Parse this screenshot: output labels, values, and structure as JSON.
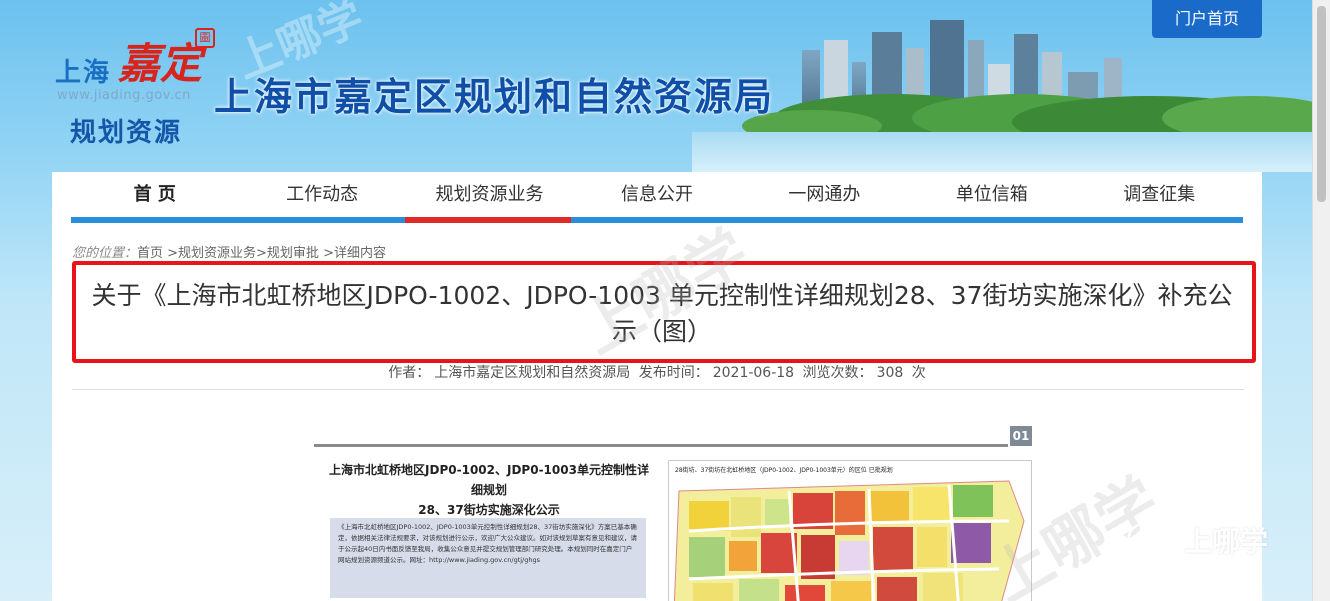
{
  "header": {
    "logo_city": "上海",
    "logo_district": "嘉定",
    "logo_seal": "圖",
    "logo_url": "www.jiading.gov.cn",
    "logo_sub": "规划资源",
    "site_title": "上海市嘉定区规划和自然资源局",
    "portal_button": "门户首页",
    "watermark": "上哪学"
  },
  "nav": {
    "items": [
      {
        "label": "首 页"
      },
      {
        "label": "工作动态"
      },
      {
        "label": "规划资源业务"
      },
      {
        "label": "信息公开"
      },
      {
        "label": "一网通办"
      },
      {
        "label": "单位信箱"
      },
      {
        "label": "调查征集"
      }
    ],
    "active_index": 2
  },
  "breadcrumb": {
    "label": "您的位置：",
    "path": "首页 >规划资源业务>规划审批 >详细内容"
  },
  "article": {
    "title": "关于《上海市北虹桥地区JDPO-1002、JDPO-1003 单元控制性详细规划28、37街坊实施深化》补充公示（图）",
    "author_label": "作者：",
    "author": "上海市嘉定区规划和自然资源局",
    "published_label": "发布时间：",
    "published": "2021-06-18",
    "views_label": "浏览次数：",
    "views": "308",
    "views_unit": "次"
  },
  "notice_image": {
    "page_number": "01",
    "heading_line1": "上海市北虹桥地区JDP0-1002、JDP0-1003单元控制性详细规划",
    "heading_line2": "28、37街坊实施深化公示",
    "body_text": "《上海市北虹桥地区JDP0-1002、JDP0-1003单元控制性详细规划28、37街坊实施深化》方案已基本确定，依据相关法律法规要求，对该规划进行公示，欢迎广大公众建议。如对该规划草案有意见和建议，请于公示起40日内书面反馈至我局，收集公众意见并提交规划管理部门研究处理。本规划同时在嘉定门户网站规划资源频道公示。网址：http://www.jiading.gov.cn/gtj/ghgs",
    "map_caption": "28街坊、37街坊在北虹桥地区（JDP0-1002、JDP0-1003单元）的区位    已批规划"
  },
  "wechat": {
    "name": "上哪学"
  },
  "colors": {
    "nav_bar": "#2a8fdb",
    "nav_active": "#e02a2a",
    "title_box": "#e8141a",
    "portal_button": "#1a6bc9"
  }
}
